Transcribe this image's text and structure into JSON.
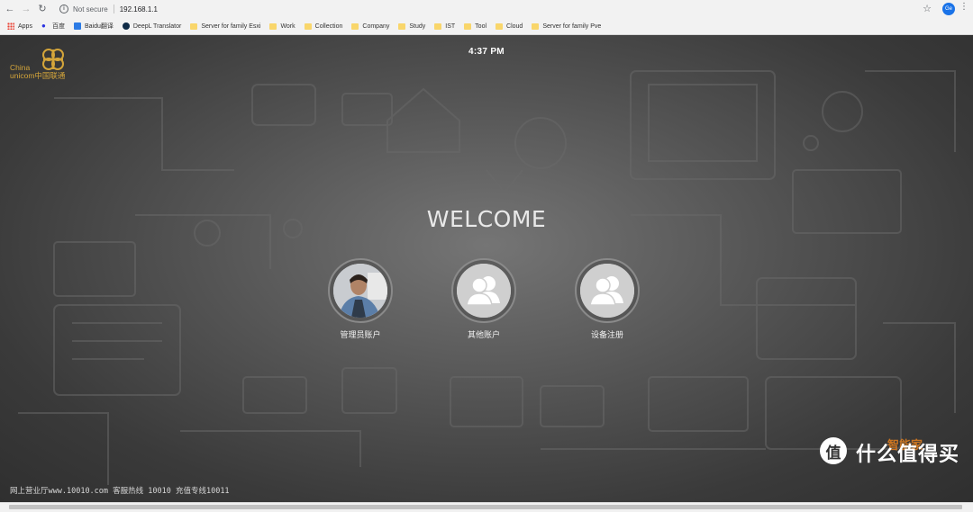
{
  "browser": {
    "security_label": "Not secure",
    "url": "192.168.1.1",
    "profile_initials": "Ge",
    "bookmarks": [
      {
        "label": "Apps",
        "icon": "apps-icon"
      },
      {
        "label": "百度",
        "icon": "baidu-icon"
      },
      {
        "label": "Baidu翻译",
        "icon": "baidu-translate-icon"
      },
      {
        "label": "DeepL Translator",
        "icon": "deepl-icon"
      },
      {
        "label": "Server for family Esxi",
        "icon": "folder-icon"
      },
      {
        "label": "Work",
        "icon": "folder-icon"
      },
      {
        "label": "Collection",
        "icon": "folder-icon"
      },
      {
        "label": "Company",
        "icon": "folder-icon"
      },
      {
        "label": "Study",
        "icon": "folder-icon"
      },
      {
        "label": "IST",
        "icon": "folder-icon"
      },
      {
        "label": "Tool",
        "icon": "folder-icon"
      },
      {
        "label": "Cloud",
        "icon": "folder-icon"
      },
      {
        "label": "Server for family Pve",
        "icon": "folder-icon"
      }
    ]
  },
  "page": {
    "logo_text_line1": "China",
    "logo_text_line2": "unicom中国联通",
    "clock": "4:37 PM",
    "welcome": "WELCOME",
    "accounts": [
      {
        "label": "管理员账户",
        "icon": "admin-photo-avatar"
      },
      {
        "label": "其他账户",
        "icon": "users-icon"
      },
      {
        "label": "设备注册",
        "icon": "users-icon"
      }
    ],
    "footer": "网上营业厅www.10010.com 客服热线 10010 充值专线10011",
    "watermark_left": "智能家",
    "watermark_badge": "值",
    "watermark_right": "什么值得买"
  },
  "colors": {
    "logo_gold": "#d4a53a",
    "profile_blue": "#1a73e8"
  }
}
